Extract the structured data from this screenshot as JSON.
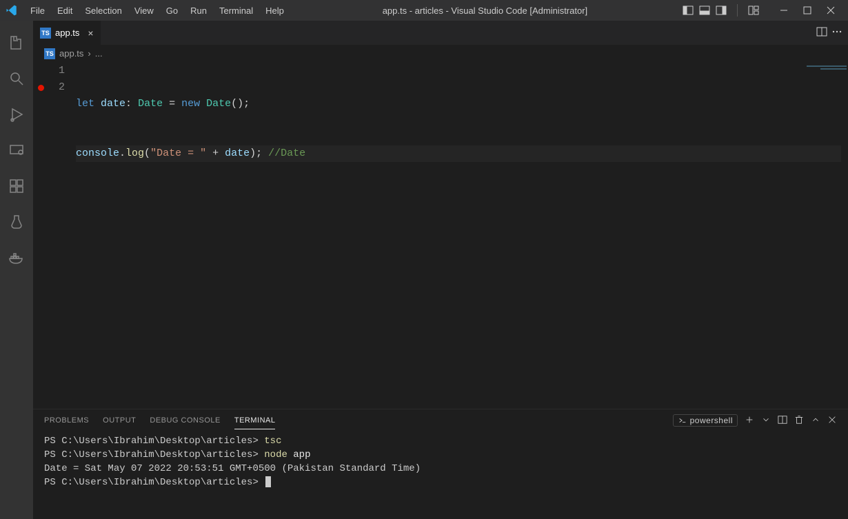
{
  "title_bar": {
    "menu": [
      "File",
      "Edit",
      "Selection",
      "View",
      "Go",
      "Run",
      "Terminal",
      "Help"
    ],
    "title": "app.ts - articles - Visual Studio Code [Administrator]"
  },
  "tabs": {
    "active": {
      "label": "app.ts",
      "lang_badge": "TS"
    }
  },
  "breadcrumb": {
    "file": "app.ts",
    "sep": "›",
    "dots": "..."
  },
  "editor": {
    "line_numbers": [
      "1",
      "2"
    ],
    "breakpoints": [
      false,
      true
    ],
    "line1": {
      "let": "let",
      "var": "date",
      "colon_sp": ": ",
      "type": "Date",
      "sp_eq_sp": " = ",
      "new": "new",
      "sp": " ",
      "ctor": "Date",
      "parens_semi": "();"
    },
    "line2": {
      "obj": "console",
      "dot": ".",
      "func": "log",
      "open": "(",
      "str": "\"Date = \"",
      "sp_plus_sp": " + ",
      "var": "date",
      "close_semi": ");",
      "sp": " ",
      "comm": "//Date"
    }
  },
  "panel": {
    "tabs": [
      "PROBLEMS",
      "OUTPUT",
      "DEBUG CONSOLE",
      "TERMINAL"
    ],
    "active_tab_index": 3,
    "shell_label": "powershell",
    "terminal": {
      "l1_prompt": "PS C:\\Users\\Ibrahim\\Desktop\\articles> ",
      "l1_cmd": "tsc",
      "l2_prompt": "PS C:\\Users\\Ibrahim\\Desktop\\articles> ",
      "l2_cmd1": "node",
      "l2_cmd2": " app",
      "l3": "Date = Sat May 07 2022 20:53:51 GMT+0500 (Pakistan Standard Time)",
      "l4_prompt": "PS C:\\Users\\Ibrahim\\Desktop\\articles> "
    }
  }
}
